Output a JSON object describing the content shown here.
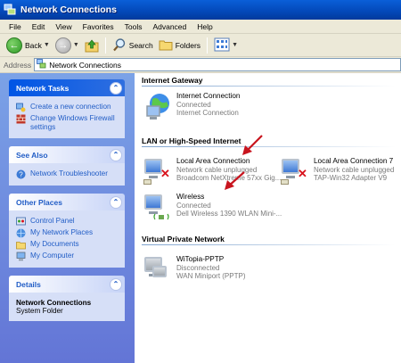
{
  "window": {
    "title": "Network Connections"
  },
  "menu": [
    "File",
    "Edit",
    "View",
    "Favorites",
    "Tools",
    "Advanced",
    "Help"
  ],
  "toolbar": {
    "back_label": "Back",
    "search_label": "Search",
    "folders_label": "Folders"
  },
  "address": {
    "label": "Address",
    "value": "Network Connections"
  },
  "sidebar": {
    "network_tasks": {
      "title": "Network Tasks",
      "items": [
        "Create a new connection",
        "Change Windows Firewall settings"
      ]
    },
    "see_also": {
      "title": "See Also",
      "items": [
        "Network Troubleshooter"
      ]
    },
    "other_places": {
      "title": "Other Places",
      "items": [
        "Control Panel",
        "My Network Places",
        "My Documents",
        "My Computer"
      ]
    },
    "details": {
      "title": "Details",
      "name": "Network Connections",
      "type": "System Folder"
    }
  },
  "groups": {
    "gateway": {
      "title": "Internet Gateway",
      "items": [
        {
          "name": "Internet Connection",
          "line1": "Connected",
          "line2": "Internet Connection"
        }
      ]
    },
    "lan": {
      "title": "LAN or High-Speed Internet",
      "items": [
        {
          "name": "Local Area Connection",
          "line1": "Network cable unplugged",
          "line2": "Broadcom NetXtreme 57xx Gig..."
        },
        {
          "name": "Local Area Connection 7",
          "line1": "Network cable unplugged",
          "line2": "TAP-Win32 Adapter V9"
        },
        {
          "name": "Wireless",
          "line1": "Connected",
          "line2": "Dell Wireless 1390 WLAN Mini-..."
        }
      ]
    },
    "vpn": {
      "title": "Virtual Private Network",
      "items": [
        {
          "name": "WiTopia-PPTP",
          "line1": "Disconnected",
          "line2": "WAN Miniport (PPTP)"
        }
      ]
    }
  },
  "colors": {
    "title_bar": "#0348b8",
    "task_pane": "#6375d6",
    "link": "#215dc6",
    "annotation_arrow": "#c8141e"
  }
}
